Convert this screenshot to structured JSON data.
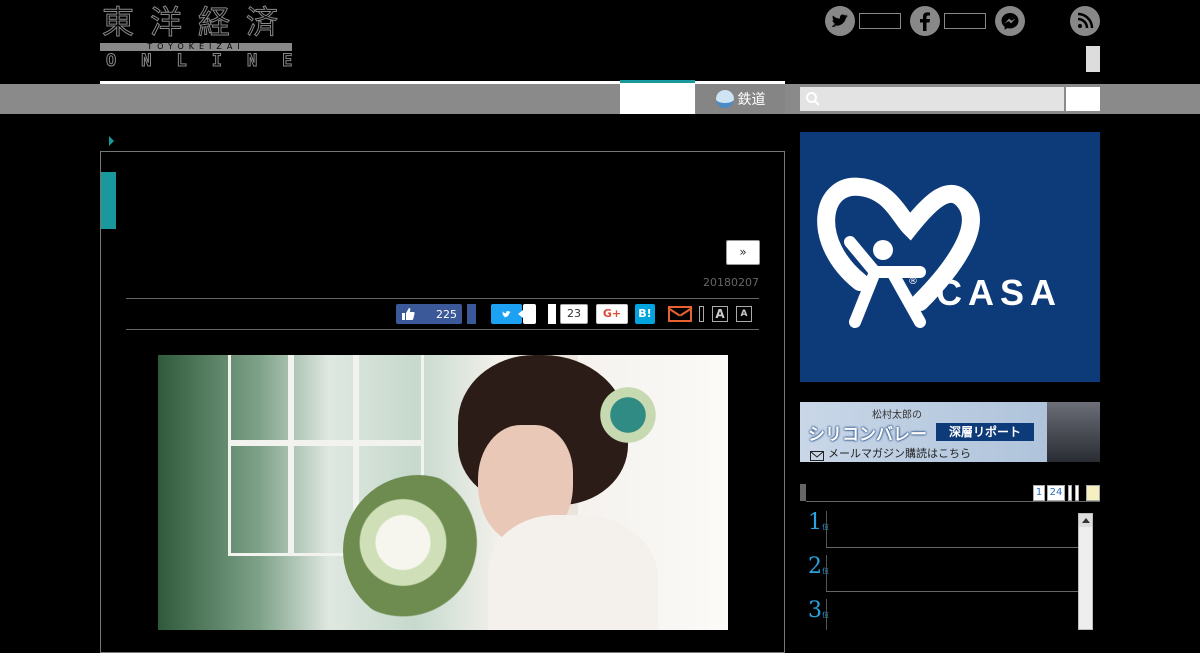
{
  "logo": {
    "kanji": "東洋経済",
    "roman": "TOYOKEIZAI",
    "online": "ONLINE"
  },
  "header": {
    "social_icons": [
      "twitter-icon",
      "facebook-icon",
      "messenger-icon",
      "rss-icon"
    ]
  },
  "nav": {
    "rail_label": "鉄道",
    "search_placeholder": ""
  },
  "article": {
    "next_button": "»",
    "date": "20180207",
    "share": {
      "like_count": "225",
      "hatena_count": "23",
      "google_label": "G+",
      "hatena_label": "B!",
      "twitter_label": "t",
      "font_large": "A",
      "font_small": "A"
    }
  },
  "sidebar": {
    "ad_casa": "CASA",
    "ad_casa_reg": "®",
    "ad_newsletter": {
      "author": "松村太郎の",
      "title": "シリコンバレー",
      "tag": "深層リポート",
      "sub": "メールマガジン購読はこちら"
    },
    "ranking": {
      "tabs": [
        "1",
        "24"
      ],
      "items": [
        {
          "rank": "1",
          "suffix": "位"
        },
        {
          "rank": "2",
          "suffix": "位"
        },
        {
          "rank": "3",
          "suffix": "位"
        }
      ]
    }
  },
  "colors": {
    "accent": "#19999b",
    "nav_gray": "#8a8a8a",
    "facebook": "#3b5998",
    "twitter": "#1da1f2",
    "hatena": "#00a4de",
    "casa_blue": "#0d3a78"
  }
}
